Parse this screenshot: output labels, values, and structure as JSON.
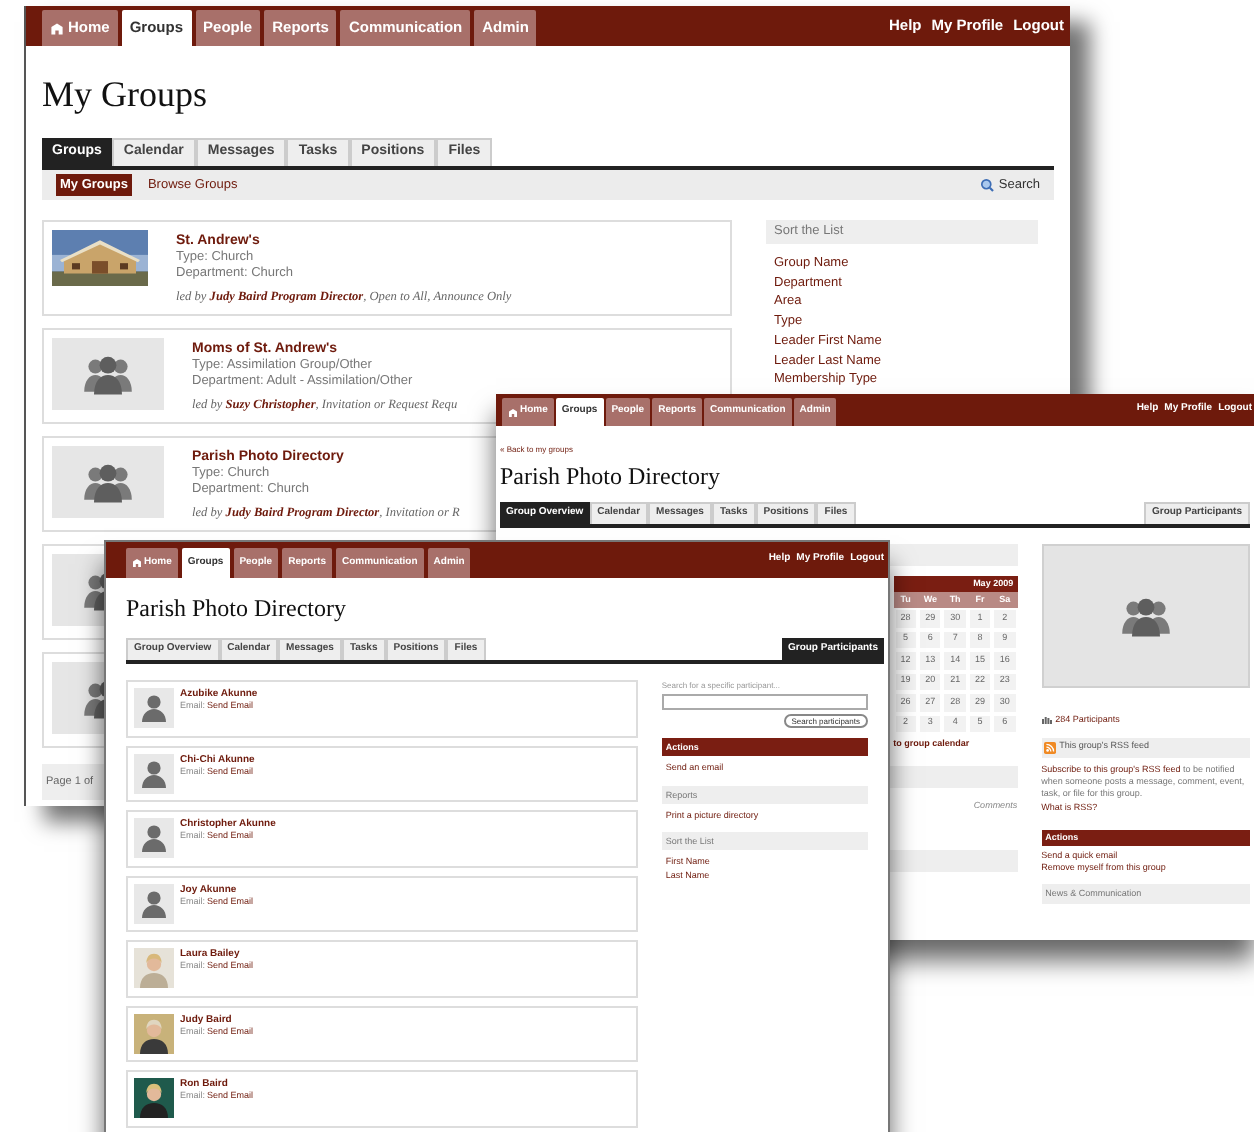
{
  "my_groups_window": {
    "nav": {
      "tabs": [
        {
          "label": "Home",
          "selected": false
        },
        {
          "label": "Groups",
          "selected": true
        },
        {
          "label": "People",
          "selected": false
        },
        {
          "label": "Reports",
          "selected": false
        },
        {
          "label": "Communication",
          "selected": false
        },
        {
          "label": "Admin",
          "selected": false
        }
      ],
      "links": [
        "Help",
        "My Profile",
        "Logout"
      ]
    },
    "title": "My Groups",
    "tabs": [
      {
        "label": "Groups",
        "selected": true
      },
      {
        "label": "Calendar",
        "selected": false
      },
      {
        "label": "Messages",
        "selected": false
      },
      {
        "label": "Tasks",
        "selected": false
      },
      {
        "label": "Positions",
        "selected": false
      },
      {
        "label": "Files",
        "selected": false
      }
    ],
    "subnav": [
      {
        "label": "My Groups",
        "selected": true
      },
      {
        "label": "Browse Groups",
        "selected": false
      }
    ],
    "search": "Search",
    "groups": [
      {
        "name": "St. Andrew's",
        "type": "Type: Church",
        "department": "Department: Church",
        "led_by": "led by **Judy Baird Program Director**, Open to All, Announce Only"
      },
      {
        "kind": "placeholder",
        "name": "Moms of St. Andrew's",
        "type": "Type: Assimilation Group/Other",
        "department": "Department: Adult - Assimilation/Other",
        "led_by": "led by **Suzy Christopher**, Invitation or Request Requ"
      },
      {
        "kind": "placeholder",
        "name": "Parish Photo Directory",
        "type": "Type: Church",
        "department": "Department: Church",
        "led_by": "led by **Judy Baird Program Director**, Invitation or R"
      },
      {
        "kind": "placeholder"
      },
      {
        "kind": "placeholder"
      }
    ],
    "pager": "Page 1 of",
    "sort": {
      "title": "Sort the List",
      "items": [
        "Group Name",
        "Department",
        "Area",
        "Type",
        "Leader First Name",
        "Leader Last Name",
        "Membership Type"
      ]
    }
  },
  "group_overview_window": {
    "nav": {
      "tabs": [
        {
          "label": "Home",
          "selected": false
        },
        {
          "label": "Groups",
          "selected": true
        },
        {
          "label": "People",
          "selected": false
        },
        {
          "label": "Reports",
          "selected": false
        },
        {
          "label": "Communication",
          "selected": false
        },
        {
          "label": "Admin",
          "selected": false
        }
      ],
      "links": [
        "Help",
        "My Profile",
        "Logout"
      ]
    },
    "back_link": "« Back to my groups",
    "title": "Parish Photo Directory",
    "tabs": [
      {
        "label": "Group Overview",
        "selected": true
      },
      {
        "label": "Calendar",
        "selected": false
      },
      {
        "label": "Messages",
        "selected": false
      },
      {
        "label": "Tasks",
        "selected": false
      },
      {
        "label": "Positions",
        "selected": false
      },
      {
        "label": "Files",
        "selected": false
      }
    ],
    "side_tab": {
      "label": "Group Participants",
      "selected": false
    },
    "calendar": {
      "month": "May 2009",
      "days": [
        "Tu",
        "We",
        "Th",
        "Fr",
        "Sa"
      ],
      "weeks": [
        [
          "28",
          "29",
          "30",
          "1",
          "2"
        ],
        [
          "5",
          "6",
          "7",
          "8",
          "9"
        ],
        [
          "12",
          "13",
          "14",
          "15",
          "16"
        ],
        [
          "19",
          "20",
          "21",
          "22",
          "23"
        ],
        [
          "26",
          "27",
          "28",
          "29",
          "30"
        ],
        [
          "2",
          "3",
          "4",
          "5",
          "6"
        ]
      ]
    },
    "calendar_link": "to group calendar",
    "comments": "Comments",
    "participants": "284 Participants",
    "rss": {
      "title": "This group's RSS feed",
      "link": "Subscribe to this group's RSS feed",
      "text": " to be notified when someone posts a message, comment, event, task, or file for this group.",
      "help": "What is RSS?"
    },
    "actions": {
      "title": "Actions",
      "items": [
        "Send a quick email",
        "Remove myself from this group"
      ]
    },
    "news_title": "News & Communication"
  },
  "participants_window": {
    "nav": {
      "tabs": [
        {
          "label": "Home",
          "selected": false
        },
        {
          "label": "Groups",
          "selected": true
        },
        {
          "label": "People",
          "selected": false
        },
        {
          "label": "Reports",
          "selected": false
        },
        {
          "label": "Communication",
          "selected": false
        },
        {
          "label": "Admin",
          "selected": false
        }
      ],
      "links": [
        "Help",
        "My Profile",
        "Logout"
      ]
    },
    "title": "Parish Photo Directory",
    "tabs": [
      {
        "label": "Group Overview",
        "selected": false
      },
      {
        "label": "Calendar",
        "selected": false
      },
      {
        "label": "Messages",
        "selected": false
      },
      {
        "label": "Tasks",
        "selected": false
      },
      {
        "label": "Positions",
        "selected": false
      },
      {
        "label": "Files",
        "selected": false
      }
    ],
    "side_tab": {
      "label": "Group Participants",
      "selected": true
    },
    "people": [
      {
        "kind": "placeholder",
        "name": "Azubike Akunne",
        "email_label": "Email:",
        "email_link": "Send Email"
      },
      {
        "kind": "placeholder",
        "name": "Chi-Chi Akunne",
        "email_label": "Email:",
        "email_link": "Send Email"
      },
      {
        "kind": "placeholder",
        "name": "Christopher Akunne",
        "email_label": "Email:",
        "email_link": "Send Email"
      },
      {
        "kind": "placeholder",
        "name": "Joy Akunne",
        "email_label": "Email:",
        "email_link": "Send Email"
      },
      {
        "name": "Laura Bailey",
        "email_label": "Email:",
        "email_link": "Send Email"
      },
      {
        "name": "Judy Baird",
        "email_label": "Email:",
        "email_link": "Send Email"
      },
      {
        "name": "Ron Baird",
        "email_label": "Email:",
        "email_link": "Send Email"
      }
    ],
    "search": {
      "label": "Search for a specific participant...",
      "button": "Search participants"
    },
    "actions": {
      "title": "Actions",
      "items": [
        "Send an email"
      ]
    },
    "reports": {
      "title": "Reports",
      "items": [
        "Print a picture directory"
      ]
    },
    "sort": {
      "title": "Sort the List",
      "items": [
        "First Name",
        "Last Name"
      ]
    }
  }
}
